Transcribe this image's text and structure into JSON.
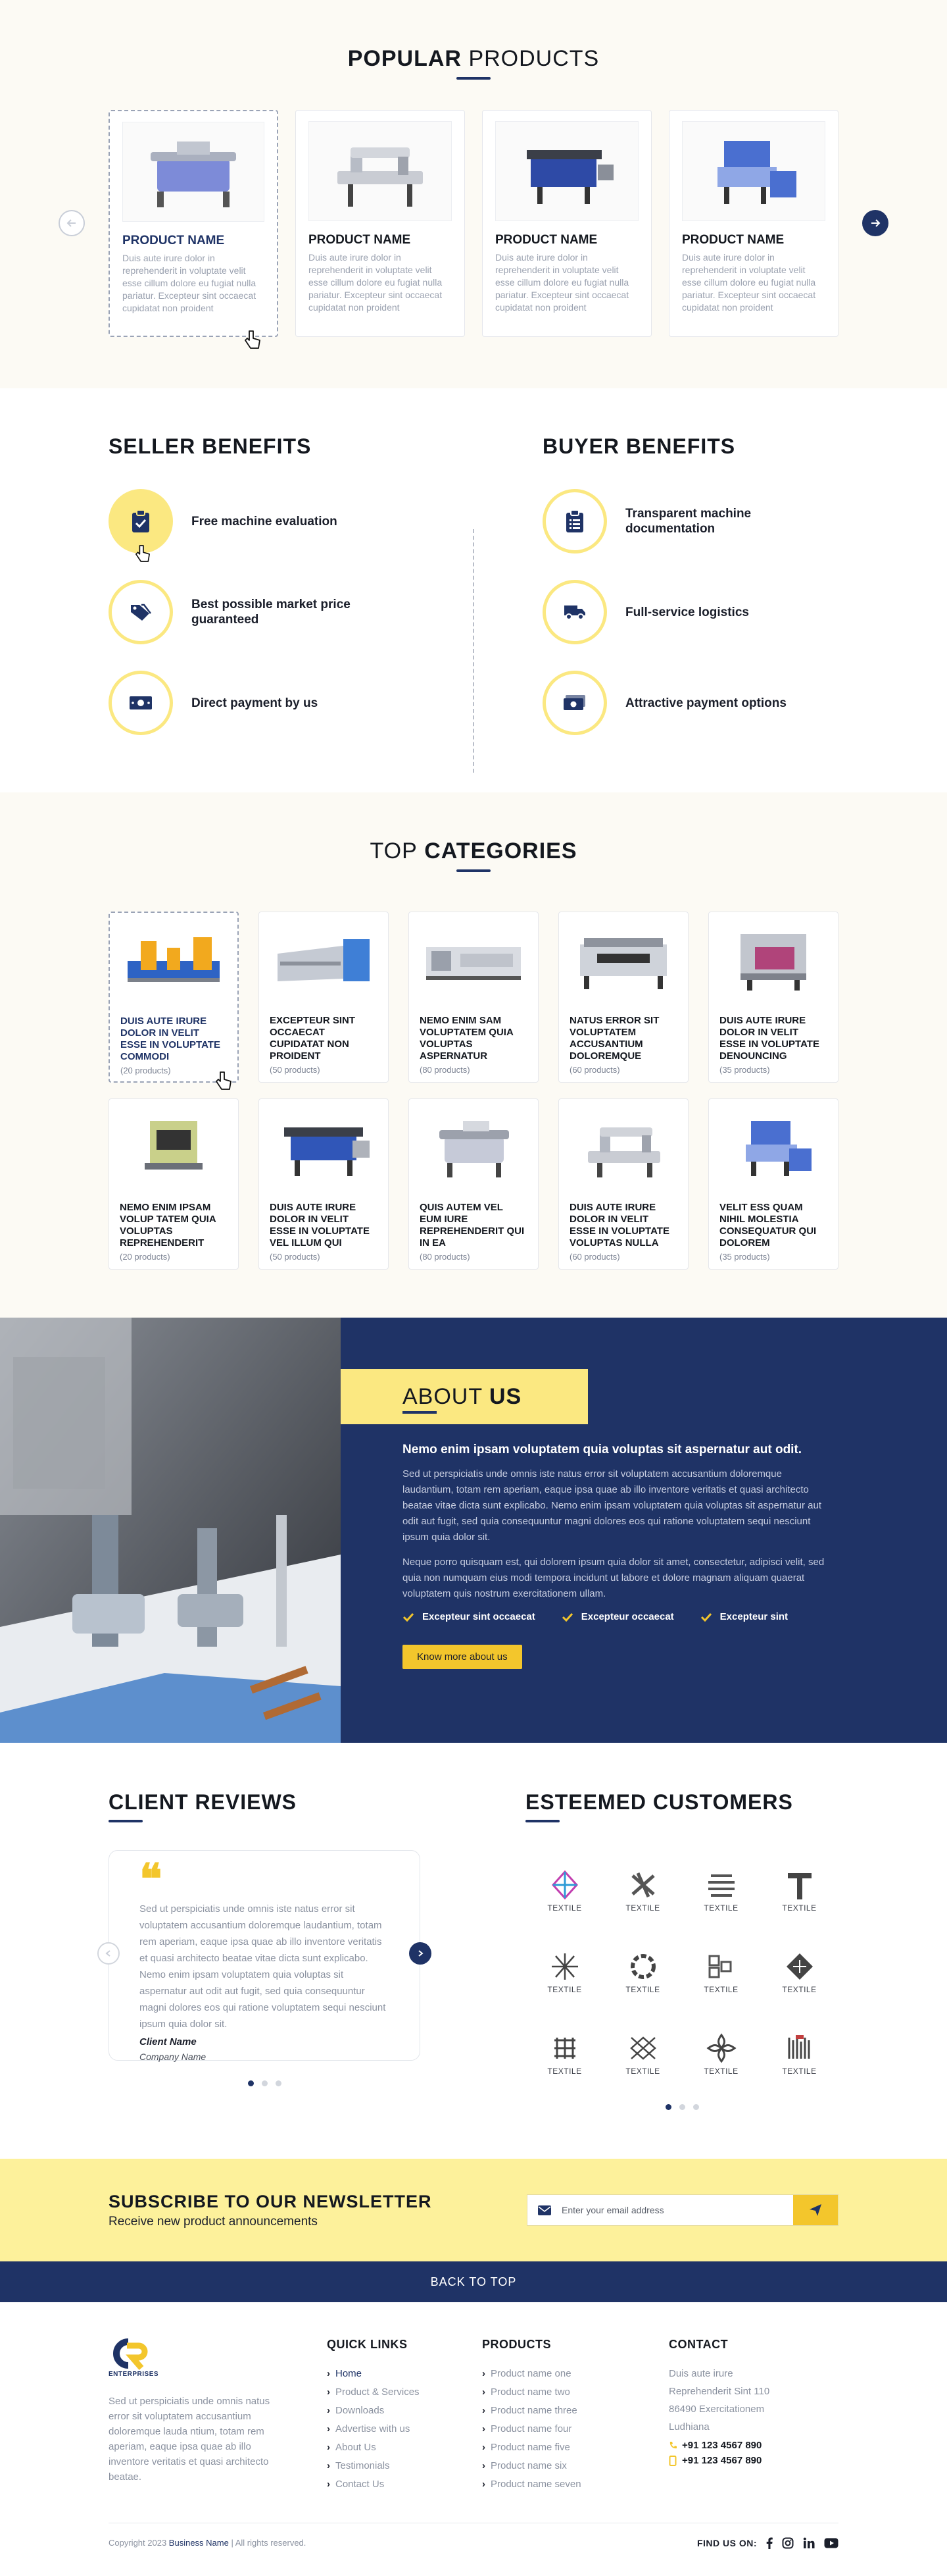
{
  "popular": {
    "title_bold": "POPULAR",
    "title_rest": "PRODUCTS",
    "products": [
      {
        "name": "PRODUCT NAME",
        "desc": "Duis aute irure dolor in reprehenderit in voluptate velit esse cillum dolore eu fugiat nulla pariatur. Excepteur sint occaecat cupidatat non proident"
      },
      {
        "name": "PRODUCT NAME",
        "desc": "Duis aute irure dolor in reprehenderit in voluptate velit esse cillum dolore eu fugiat nulla pariatur. Excepteur sint occaecat cupidatat non proident"
      },
      {
        "name": "PRODUCT NAME",
        "desc": "Duis aute irure dolor in reprehenderit in voluptate velit esse cillum dolore eu fugiat nulla pariatur. Excepteur sint occaecat cupidatat non proident"
      },
      {
        "name": "PRODUCT NAME",
        "desc": "Duis aute irure dolor in reprehenderit in voluptate velit esse cillum dolore eu fugiat nulla pariatur. Excepteur sint occaecat cupidatat non proident"
      }
    ]
  },
  "seller": {
    "title_bold": "SELLER",
    "title_rest": "BENEFITS",
    "items": [
      {
        "label": "Free machine evaluation",
        "icon": "clipboard-check-icon"
      },
      {
        "label": "Best possible market price guaranteed",
        "icon": "price-tags-icon"
      },
      {
        "label": "Direct payment by us",
        "icon": "money-bill-icon"
      }
    ]
  },
  "buyer": {
    "title_bold": "BUYER",
    "title_rest": "BENEFITS",
    "items": [
      {
        "label": "Transparent machine documentation",
        "icon": "clipboard-list-icon"
      },
      {
        "label": "Full-service logistics",
        "icon": "truck-icon"
      },
      {
        "label": "Attractive payment options",
        "icon": "money-check-icon"
      }
    ]
  },
  "categories": {
    "title_rest": "TOP",
    "title_bold": "CATEGORIES",
    "items": [
      {
        "name": "DUIS AUTE IRURE DOLOR IN VELIT ESSE IN VOLUPTATE COMMODI",
        "count": "(20 products)"
      },
      {
        "name": "EXCEPTEUR SINT OCCAECAT CUPIDATAT NON PROIDENT",
        "count": "(50 products)"
      },
      {
        "name": "NEMO ENIM SAM VOLUPTATEM QUIA VOLUPTAS ASPERNATUR",
        "count": "(80 products)"
      },
      {
        "name": "NATUS ERROR SIT VOLUPTATEM ACCUSANTIUM DOLOREMQUE",
        "count": "(60 products)"
      },
      {
        "name": "DUIS AUTE IRURE DOLOR IN VELIT ESSE IN VOLUPTATE DENOUNCING",
        "count": "(35 products)"
      },
      {
        "name": "NEMO ENIM IPSAM VOLUP TATEM QUIA VOLUPTAS REPREHENDERIT",
        "count": "(20 products)"
      },
      {
        "name": "DUIS AUTE IRURE DOLOR IN VELIT ESSE IN VOLUPTATE VEL ILLUM QUI",
        "count": "(50 products)"
      },
      {
        "name": "QUIS AUTEM VEL EUM IURE REPREHENDERIT QUI IN EA",
        "count": "(80 products)"
      },
      {
        "name": "DUIS AUTE IRURE DOLOR IN VELIT ESSE IN VOLUPTATE VOLUPTAS NULLA",
        "count": "(60 products)"
      },
      {
        "name": "VELIT ESS QUAM NIHIL MOLESTIA CONSEQUATUR QUI DOLOREM",
        "count": "(35 products)"
      }
    ]
  },
  "about": {
    "title_rest": "ABOUT",
    "title_bold": "US",
    "lead": "Nemo enim ipsam voluptatem quia voluptas sit aspernatur aut odit.",
    "p1": "Sed ut perspiciatis unde omnis iste natus error sit voluptatem accusantium doloremque laudantium, totam rem aperiam, eaque ipsa quae ab illo inventore veritatis et quasi architecto beatae vitae dicta sunt explicabo. Nemo enim ipsam voluptatem quia voluptas sit aspernatur aut odit aut fugit, sed quia consequuntur magni dolores eos qui ratione voluptatem sequi nesciunt  ipsum quia dolor sit.",
    "p2": "Neque porro quisquam est, qui dolorem ipsum quia dolor sit amet, consectetur, adipisci velit, sed quia non numquam eius modi tempora incidunt ut labore et dolore magnam aliquam quaerat voluptatem quis nostrum exercitationem ullam.",
    "checks": [
      "Excepteur sint occaecat",
      "Excepteur occaecat",
      "Excepteur sint"
    ],
    "button": "Know more about us"
  },
  "reviews": {
    "title_rest": "CLIENT",
    "title_bold": "REVIEWS",
    "text": "Sed ut perspiciatis unde omnis iste natus error sit voluptatem accusantium doloremque laudantium, totam rem aperiam, eaque ipsa quae ab illo inventore veritatis et quasi architecto beatae vitae dicta sunt explicabo. Nemo enim ipsam voluptatem quia voluptas sit aspernatur aut odit aut fugit, sed quia consequuntur magni dolores eos qui ratione voluptatem sequi nesciunt  ipsum quia dolor sit.",
    "client_name": "Client Name",
    "company": "Company Name"
  },
  "customers": {
    "title_rest": "ESTEEMED",
    "title_bold": "CUSTOMERS",
    "logo_label": "TEXTILE"
  },
  "newsletter": {
    "title": "SUBSCRIBE TO OUR NEWSLETTER",
    "subtitle": "Receive new product announcements",
    "placeholder": "Enter your email address"
  },
  "backtop": {
    "label": "BACK TO TOP"
  },
  "footer": {
    "logo_text": "ENTERPRISES",
    "about": "Sed ut perspiciatis unde omnis natus error sit voluptatem accusantium doloremque lauda ntium, totam rem aperiam, eaque ipsa quae ab illo inventore veritatis et quasi architecto beatae.",
    "quick_title": "QUICK LINKS",
    "quick_links": [
      "Home",
      "Product & Services",
      "Downloads",
      "Advertise with us",
      "About Us",
      "Testimonials",
      "Contact Us"
    ],
    "products_title": "PRODUCTS",
    "product_links": [
      "Product name one",
      "Product name two",
      "Product name three",
      "Product name four",
      "Product name five",
      "Product name six",
      "Product name seven"
    ],
    "contact_title": "CONTACT",
    "address": [
      "Duis aute irure",
      "Reprehenderit Sint 110",
      "86490 Exercitationem",
      "Ludhiana"
    ],
    "phone1": "+91 123 4567 890",
    "phone2": "+91 123 4567 890",
    "copyright_pre": "Copyright 2023",
    "business_name": "Business Name",
    "copyright_post": "| All rights reserved.",
    "find_us": "FIND US ON:"
  },
  "colors": {
    "navy": "#1f3366",
    "yellow": "#fbe881",
    "gold": "#f3c62c",
    "cream": "#fcfaf4"
  }
}
